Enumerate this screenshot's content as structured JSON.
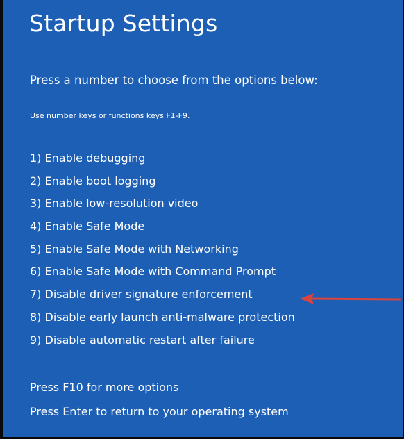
{
  "screen": {
    "title": "Startup Settings",
    "subtitle": "Press a number to choose from the options below:",
    "hint": "Use number keys or functions keys F1-F9."
  },
  "options": [
    "1) Enable debugging",
    "2) Enable boot logging",
    "3) Enable low-resolution video",
    "4) Enable Safe Mode",
    "5) Enable Safe Mode with Networking",
    "6) Enable Safe Mode with Command Prompt",
    "7) Disable driver signature enforcement",
    "8) Disable early launch anti-malware protection",
    "9) Disable automatic restart after failure"
  ],
  "footer": {
    "more_options": "Press F10 for more options",
    "return": "Press Enter to return to your operating system"
  },
  "colors": {
    "background": "#1c5fb5",
    "text": "#ffffff",
    "arrow": "#d9443c"
  },
  "annotation": {
    "icon": "red-arrow-icon",
    "points_to_option": 7
  }
}
